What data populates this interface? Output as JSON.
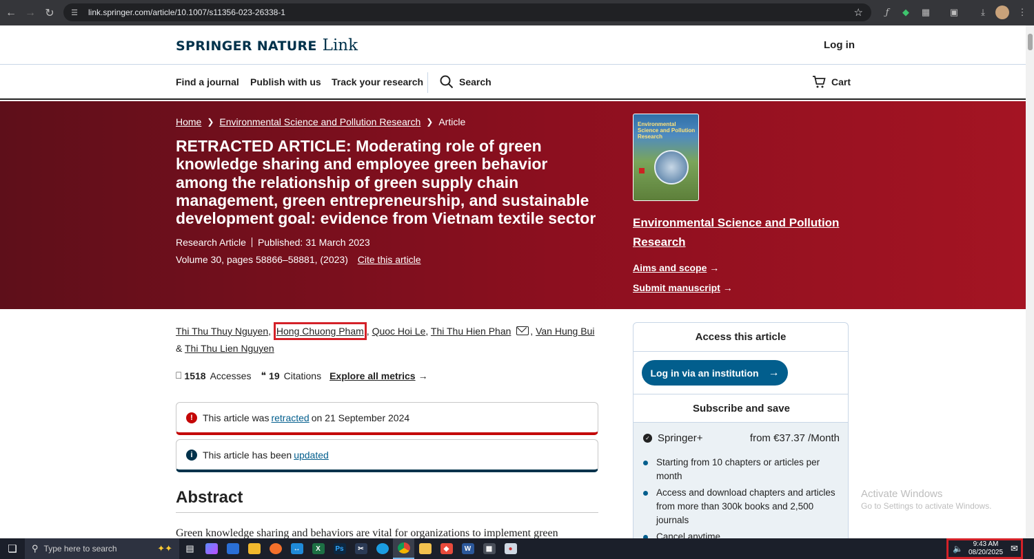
{
  "browser": {
    "url": "link.springer.com/article/10.1007/s11356-023-26338-1",
    "back_icon": "←",
    "forward_icon": "→",
    "reload_icon": "↻",
    "star_icon": "☆"
  },
  "header": {
    "brand": "SPRINGER NATURE",
    "brand_suffix": "Link",
    "login": "Log in"
  },
  "nav": {
    "items": [
      "Find a journal",
      "Publish with us",
      "Track your research"
    ],
    "search": "Search",
    "cart": "Cart"
  },
  "breadcrumb": {
    "home": "Home",
    "journal": "Environmental Science and Pollution Research",
    "current": "Article"
  },
  "article": {
    "title": "RETRACTED ARTICLE: Moderating role of green knowledge sharing and employee green behavior among the relationship of green supply chain management, green entrepreneurship, and sustainable development goal: evidence from Vietnam textile sector",
    "type": "Research Article",
    "published": "Published: 31 March 2023",
    "volume": "Volume 30, pages 58866–58881, (2023)",
    "cite": "Cite this article"
  },
  "journal_panel": {
    "cover_title": "Environmental Science and Pollution Research",
    "name": "Environmental Science and Pollution Research",
    "aims": "Aims and scope",
    "submit": "Submit manuscript"
  },
  "authors": {
    "list": [
      "Thi Thu Thuy Nguyen",
      "Hong Chuong Pham",
      "Quoc Hoi Le",
      "Thi Thu Hien Phan",
      "Van Hung Bui",
      "Thi Thu Lien Nguyen"
    ],
    "and": "&"
  },
  "metrics": {
    "accesses_count": "1518",
    "accesses_label": "Accesses",
    "citations_count": "19",
    "citations_label": "Citations",
    "explore": "Explore all metrics"
  },
  "notices": {
    "retracted_pre": "This article was",
    "retracted_link": "retracted",
    "retracted_post": "on 21 September 2024",
    "updated_pre": "This article has been",
    "updated_link": "updated"
  },
  "abstract": {
    "heading": "Abstract",
    "text": "Green knowledge sharing and behaviors are vital for organizations to implement green"
  },
  "access": {
    "heading": "Access this article",
    "institution_button": "Log in via an institution",
    "subscribe_heading": "Subscribe and save",
    "plan_name": "Springer+",
    "plan_price": "from €37.37 /Month",
    "features": [
      "Starting from 10 chapters or articles per month",
      "Access and download chapters and articles from more than 300k books and 2,500 journals",
      "Cancel anytime"
    ]
  },
  "watermark": {
    "line1": "Activate Windows",
    "line2": "Go to Settings to activate Windows."
  },
  "taskbar": {
    "search_placeholder": "Type here to search",
    "time": "9:43 AM",
    "date": "08/20/2025"
  },
  "colors": {
    "brand_navy": "#01324b",
    "hero_red": "#8d0f1f",
    "link_blue": "#025e8d",
    "retracted_red": "#c40606",
    "highlight_box": "#d42128"
  }
}
